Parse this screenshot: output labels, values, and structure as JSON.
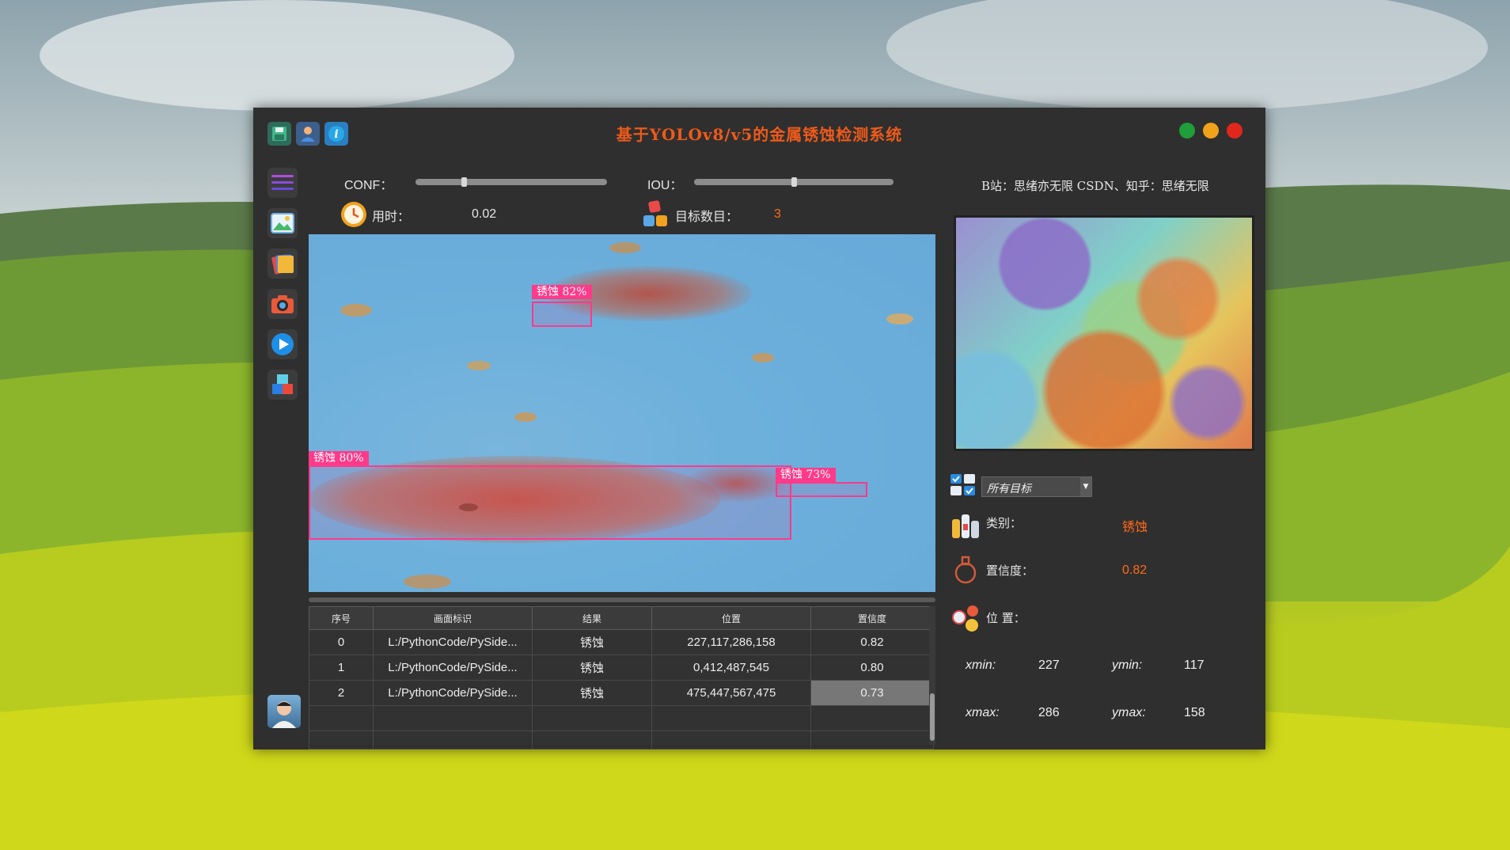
{
  "window": {
    "title": "基于YOLOv8/v5的金属锈蚀检测系统",
    "accent_title_color": "#ef5a1a",
    "window_buttons": [
      "green",
      "yellow",
      "red"
    ]
  },
  "toolbar_icons": [
    "save-icon",
    "user-icon",
    "info-icon"
  ],
  "sidebar": {
    "icons": [
      "menu-icon",
      "image-icon",
      "folder-icon",
      "camera-icon",
      "video-play-icon",
      "model-icon"
    ],
    "avatar": "avatar"
  },
  "controls": {
    "conf_label": "CONF：",
    "conf_value": 0.25,
    "iou_label": "IOU：",
    "iou_value": 0.5,
    "time_label": "用时：",
    "time_value": "0.02",
    "count_label": "目标数目：",
    "count_value": "3"
  },
  "credits": "B站：思绪亦无限  CSDN、知乎：思绪无限",
  "detections": [
    {
      "label": "锈蚀  82%"
    },
    {
      "label": "锈蚀  80%"
    },
    {
      "label": "锈蚀  73%"
    }
  ],
  "table": {
    "headers": [
      "序号",
      "画面标识",
      "结果",
      "位置",
      "置信度"
    ],
    "rows": [
      [
        "0",
        "L:/PythonCode/PySide...",
        "锈蚀",
        "227,117,286,158",
        "0.82"
      ],
      [
        "1",
        "L:/PythonCode/PySide...",
        "锈蚀",
        "0,412,487,545",
        "0.80"
      ],
      [
        "2",
        "L:/PythonCode/PySide...",
        "锈蚀",
        "475,447,567,475",
        "0.73"
      ],
      [
        "",
        "",
        "",
        "",
        ""
      ],
      [
        "",
        "",
        "",
        "",
        ""
      ]
    ]
  },
  "details": {
    "target_select": "所有目标",
    "class_label": "类别：",
    "class_value": "锈蚀",
    "conf_label": "置信度：",
    "conf_value": "0.82",
    "position_label": "位 置：",
    "xmin_label": "xmin:",
    "xmin_value": "227",
    "ymin_label": "ymin:",
    "ymin_value": "117",
    "xmax_label": "xmax:",
    "xmax_value": "286",
    "ymax_label": "ymax:",
    "ymax_value": "158"
  }
}
